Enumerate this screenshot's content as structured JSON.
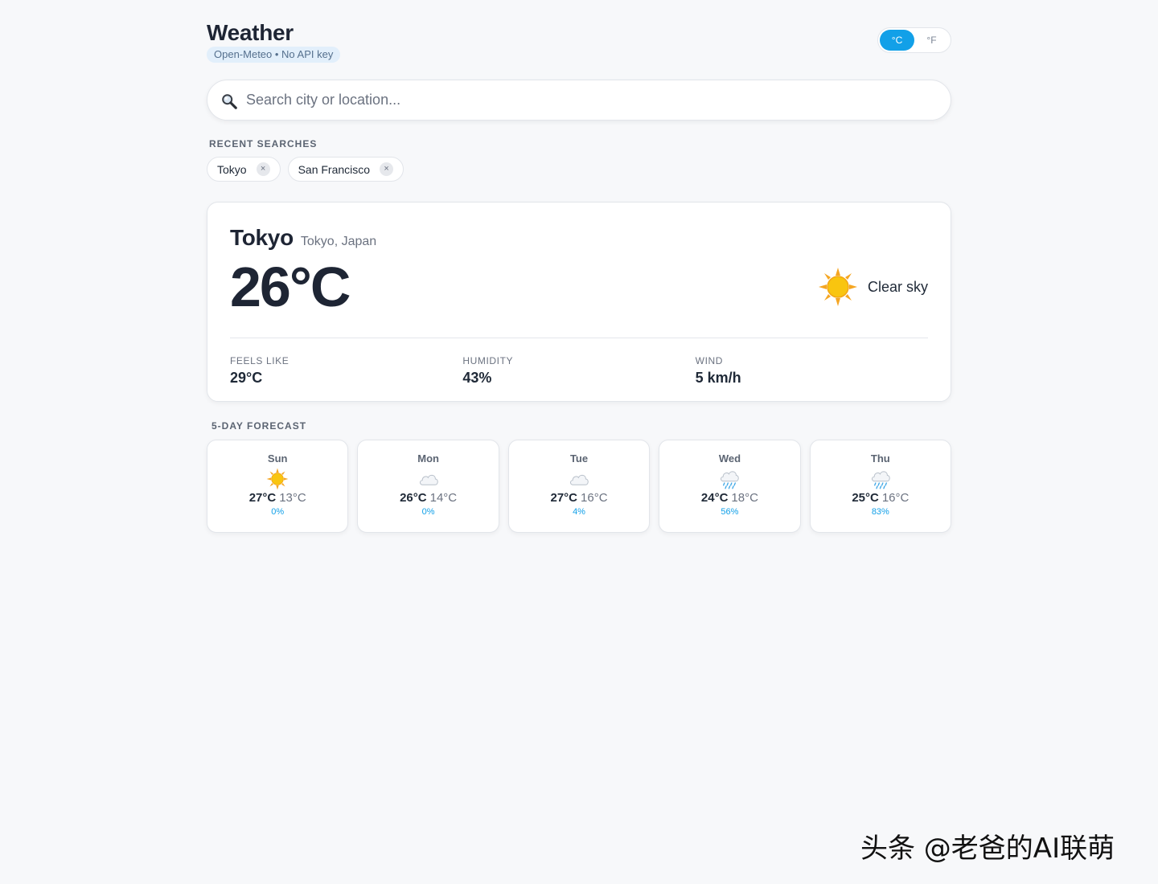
{
  "app": {
    "title": "Weather",
    "source_badge": "Open-Meteo • No API key"
  },
  "units": {
    "celsius_label": "°C",
    "fahrenheit_label": "°F",
    "active": "celsius"
  },
  "search": {
    "placeholder": "Search city or location...",
    "value": ""
  },
  "recent": {
    "label": "RECENT SEARCHES",
    "items": [
      {
        "label": "Tokyo",
        "remove": "×"
      },
      {
        "label": "San Francisco",
        "remove": "×"
      }
    ]
  },
  "current": {
    "city": "Tokyo",
    "region": "Tokyo, Japan",
    "temperature": "26°C",
    "condition": "Clear sky",
    "condition_icon": "sun-icon",
    "stats": [
      {
        "label": "FEELS LIKE",
        "value": "29°C"
      },
      {
        "label": "HUMIDITY",
        "value": "43%"
      },
      {
        "label": "WIND",
        "value": "5 km/h"
      }
    ]
  },
  "forecast": {
    "label": "5-DAY FORECAST",
    "days": [
      {
        "day": "Sun",
        "icon": "sun-icon",
        "high": "27°C",
        "low": "13°C",
        "precip": "0%"
      },
      {
        "day": "Mon",
        "icon": "cloud-icon",
        "high": "26°C",
        "low": "14°C",
        "precip": "0%"
      },
      {
        "day": "Tue",
        "icon": "cloud-icon",
        "high": "27°C",
        "low": "16°C",
        "precip": "4%"
      },
      {
        "day": "Wed",
        "icon": "rain-cloud-icon",
        "high": "24°C",
        "low": "18°C",
        "precip": "56%"
      },
      {
        "day": "Thu",
        "icon": "rain-cloud-icon",
        "high": "25°C",
        "low": "16°C",
        "precip": "83%"
      }
    ]
  },
  "colors": {
    "accent": "#12a0e8",
    "background": "#f7f8fa",
    "text": "#1e2534"
  },
  "watermark": "头条 @老爸的AI联萌"
}
